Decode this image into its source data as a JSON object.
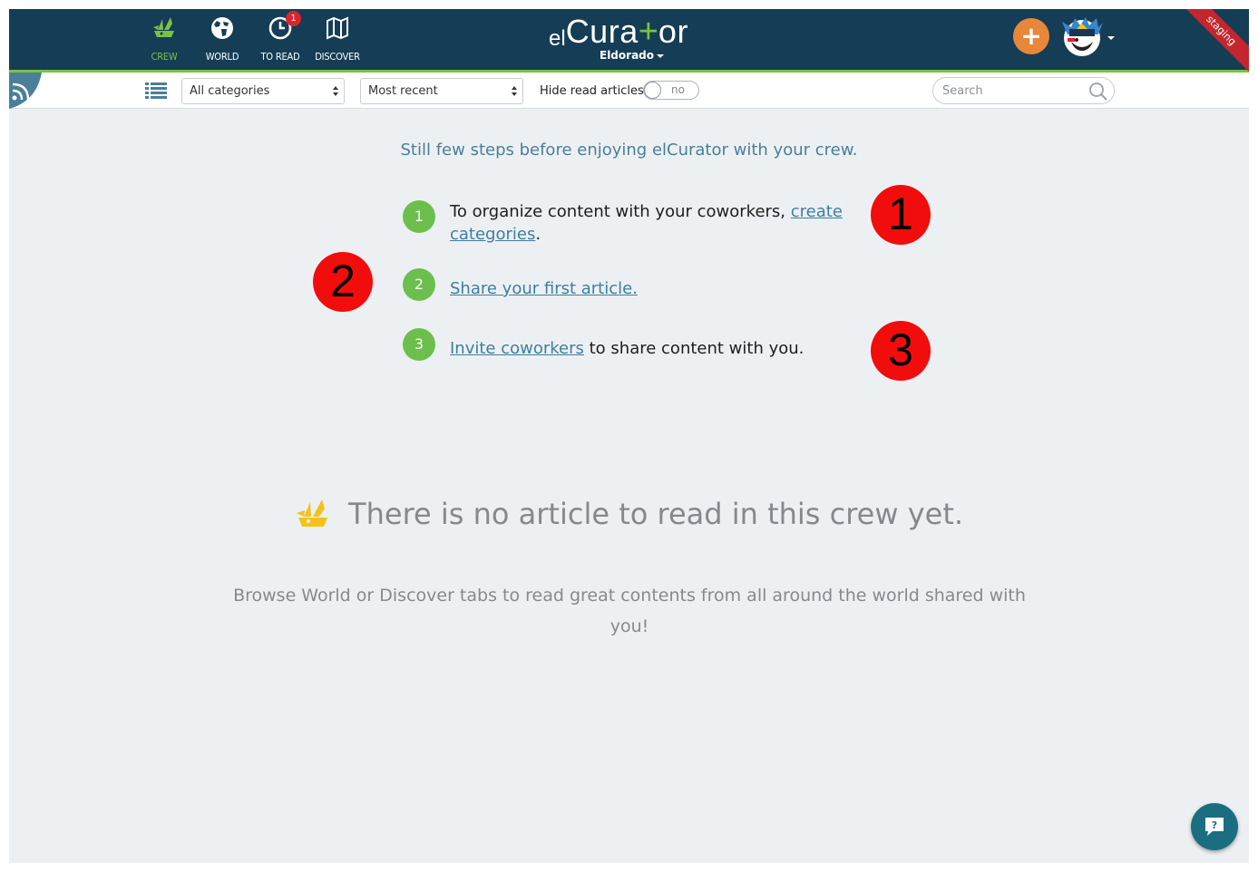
{
  "nav": {
    "items": [
      {
        "label": "CREW",
        "icon": "crew-ship-icon",
        "active": true
      },
      {
        "label": "WORLD",
        "icon": "world-icon",
        "active": false
      },
      {
        "label": "TO READ",
        "icon": "clock-icon",
        "active": false,
        "badge": "1"
      },
      {
        "label": "DISCOVER",
        "icon": "map-icon",
        "active": false
      }
    ]
  },
  "logo": {
    "el": "el",
    "cura": "Cura",
    "plus": "+",
    "or": "or"
  },
  "crew": {
    "name": "Eldorado"
  },
  "header": {
    "add_label": "+",
    "staging_label": "staging"
  },
  "toolbar": {
    "category": "All categories",
    "sort": "Most recent",
    "hide_read_label": "Hide read articles",
    "toggle_state": "no",
    "search_placeholder": "Search"
  },
  "onboarding": {
    "intro": "Still few steps before enjoying elCurator with your crew.",
    "steps": [
      {
        "num": "1",
        "before": "To organize content with your coworkers, ",
        "link": "create categories",
        "after": "."
      },
      {
        "num": "2",
        "before": "",
        "link": "Share your first article.",
        "after": ""
      },
      {
        "num": "3",
        "before": "",
        "link": "Invite coworkers",
        "after": " to share content with you."
      }
    ],
    "markers": [
      "1",
      "2",
      "3"
    ]
  },
  "empty_state": {
    "title": "There is no article to read in this crew yet.",
    "browse": "Browse World or Discover tabs to read great contents from all around the world shared with you!"
  },
  "colors": {
    "navy": "#153d55",
    "green": "#7bc143",
    "orange": "#e8863a",
    "link": "#3f7ea0",
    "marker_red": "#f20d0d"
  }
}
